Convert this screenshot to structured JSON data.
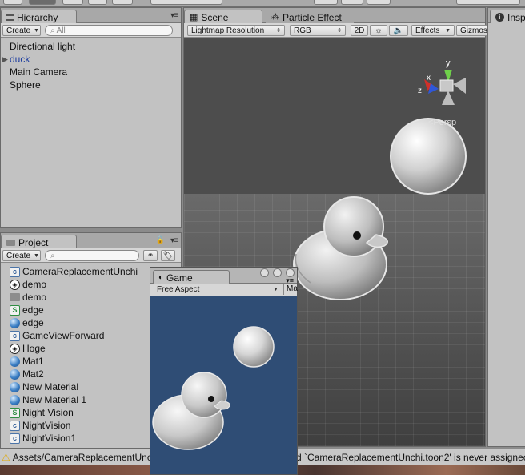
{
  "hierarchy": {
    "tab_label": "Hierarchy",
    "create_label": "Create",
    "search_placeholder": "All",
    "items": [
      {
        "label": "Directional light",
        "selected": false
      },
      {
        "label": "duck",
        "selected": true
      },
      {
        "label": "Main Camera",
        "selected": false
      },
      {
        "label": "Sphere",
        "selected": false
      }
    ]
  },
  "scene": {
    "tab_label": "Scene",
    "tab2_label": "Particle Effect",
    "toolbar": {
      "lightmap": "Lightmap Resolution",
      "rgb": "RGB",
      "mode2d": "2D",
      "effects": "Effects",
      "gizmos": "Gizmos"
    },
    "gizmo": {
      "x": "x",
      "y": "y",
      "z": "z",
      "persp": "Persp"
    }
  },
  "inspector": {
    "tab_label": "Insp"
  },
  "project": {
    "tab_label": "Project",
    "create_label": "Create",
    "items": [
      {
        "label": "CameraReplacementUnchi",
        "icon": "script-icon"
      },
      {
        "label": "demo",
        "icon": "unity-scene-icon"
      },
      {
        "label": "demo",
        "icon": "folder-icon"
      },
      {
        "label": "edge",
        "icon": "shader-icon"
      },
      {
        "label": "edge",
        "icon": "material-icon"
      },
      {
        "label": "GameViewForward",
        "icon": "script-icon"
      },
      {
        "label": "Hoge",
        "icon": "unity-scene-icon"
      },
      {
        "label": "Mat1",
        "icon": "material-icon"
      },
      {
        "label": "Mat2",
        "icon": "material-icon"
      },
      {
        "label": "New Material",
        "icon": "material-icon"
      },
      {
        "label": "New Material 1",
        "icon": "material-icon"
      },
      {
        "label": "Night Vision",
        "icon": "shader-icon"
      },
      {
        "label": "NightVision",
        "icon": "script-icon"
      },
      {
        "label": "NightVision1",
        "icon": "script-icon"
      }
    ]
  },
  "game": {
    "tab_label": "Game",
    "aspect": "Free Aspect",
    "next_dropdown": "Ma"
  },
  "status": {
    "left": "Assets/CameraReplacementUnc",
    "right": "d `CameraReplacementUnchi.toon2' is never assignec"
  }
}
